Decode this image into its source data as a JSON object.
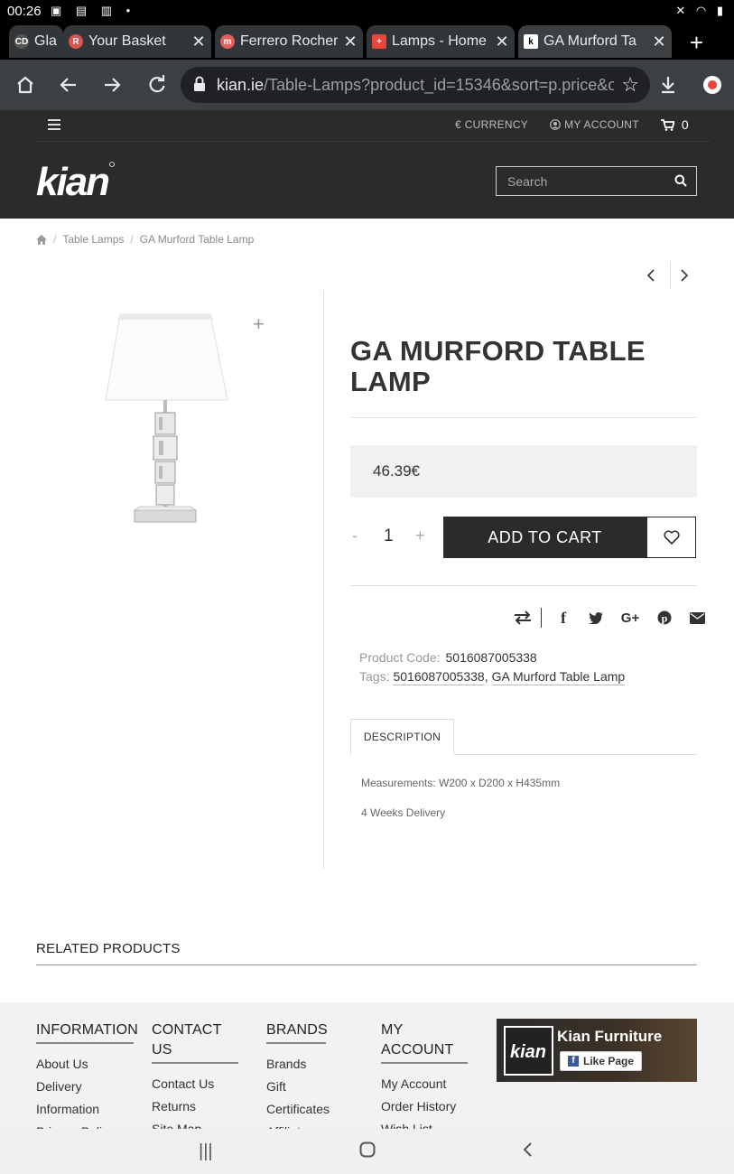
{
  "status_bar": {
    "time": "00:26"
  },
  "tabs": [
    {
      "title": "Gla",
      "favicon_color": "#555555",
      "favicon_text": "CD"
    },
    {
      "title": "Your Basket",
      "favicon_color": "#d9534f",
      "favicon_text": "R"
    },
    {
      "title": "Ferrero Rocher",
      "favicon_color": "#e85d5d",
      "favicon_text": "m"
    },
    {
      "title": "Lamps - Home",
      "favicon_color": "#e8453c",
      "favicon_text": "+"
    },
    {
      "title": "GA Murford Ta",
      "favicon_color": "#ffffff",
      "favicon_text": "k"
    }
  ],
  "address_bar": {
    "host": "kian.ie",
    "path": "/Table-Lamps?product_id=15346&sort=p.price&o"
  },
  "site_header": {
    "currency_label": "€ CURRENCY",
    "account_label": "MY ACCOUNT",
    "cart_count": "0",
    "logo_text": "kian",
    "search_placeholder": "Search"
  },
  "breadcrumb": {
    "item1": "Table Lamps",
    "item2": "GA Murford Table Lamp"
  },
  "product": {
    "title": "GA MURFORD TABLE LAMP",
    "price": "46.39€",
    "qty_minus": "-",
    "quantity": "1",
    "qty_plus": "+",
    "add_to_cart": "ADD TO CART",
    "code_label": "Product Code:",
    "code_value": "5016087005338",
    "tags_label": "Tags:",
    "tag1": "5016087005338",
    "tag_sep": ",",
    "tag2": "GA Murford Table Lamp",
    "desc_tab": "DESCRIPTION",
    "measurements": "Measurements: W200 x D200 x H435mm",
    "delivery": "4 Weeks Delivery"
  },
  "related_heading": "RELATED PRODUCTS",
  "footer": {
    "information": {
      "heading": "INFORMATION",
      "links": [
        "About Us",
        "Delivery",
        "Information",
        "Privacy Policy"
      ]
    },
    "contact": {
      "heading_line1": "CONTACT",
      "heading_line2": "US",
      "links": [
        "Contact Us",
        "Returns",
        "Site Map"
      ]
    },
    "brands": {
      "heading": "BRANDS",
      "links": [
        "Brands",
        "Gift",
        "Certificates",
        "Affiliate"
      ]
    },
    "account": {
      "heading_line1": "MY",
      "heading_line2": "ACCOUNT",
      "links": [
        "My Account",
        "Order History",
        "Wish List"
      ]
    },
    "facebook": {
      "page_name": "Kian Furniture",
      "like_label": "Like Page"
    }
  },
  "colors": {
    "header_bg": "#2b2b2b",
    "chrome_toolbar": "#3c4043",
    "button_dark": "#2b2b2b"
  }
}
